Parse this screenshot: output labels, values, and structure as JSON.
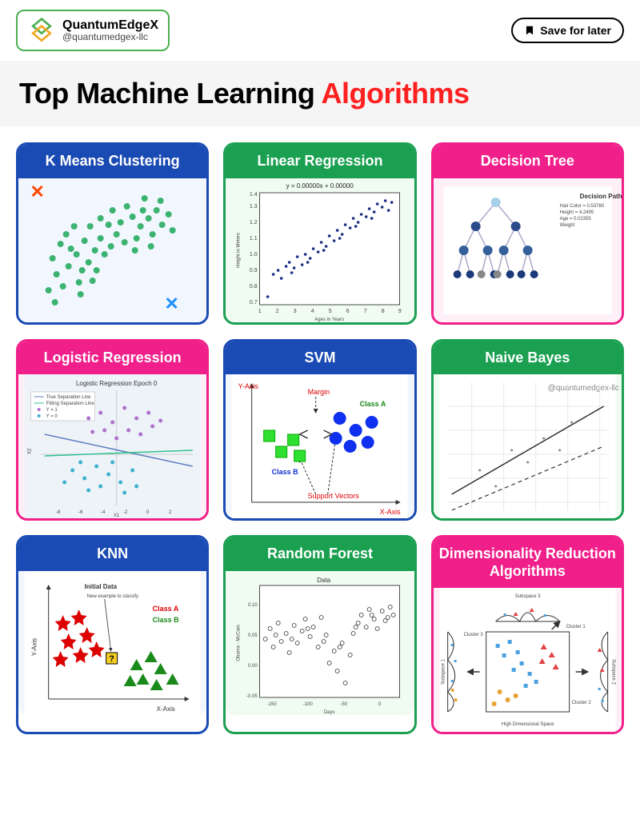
{
  "brand": {
    "name": "QuantumEdgeX",
    "handle": "@quantumedgex-llc"
  },
  "save_button": "Save for later",
  "title_prefix": "Top Machine Learning ",
  "title_accent": "Algorithms",
  "cards": {
    "kmeans": {
      "title": "K Means Clustering"
    },
    "linreg": {
      "title": "Linear Regression",
      "equation": "y = 0.00000x + 0.00000",
      "xlabel": "Ages in Years",
      "ylabel": "Height in Meters"
    },
    "dtree": {
      "title": "Decision Tree",
      "panel_title": "Decision Path",
      "panel_lines": [
        "Hair Color = 0.53780",
        "Height = 4.2495",
        "Age = 0.02355",
        "Weight"
      ]
    },
    "logreg": {
      "title": "Logistic Regression",
      "subtitle": "Logistic Regression Epoch 0",
      "legend": [
        "True Separation Line",
        "Fitting Separation Line",
        "Y = 1",
        "Y = 0"
      ],
      "xlabel": "X1",
      "ylabel": "X2"
    },
    "svm": {
      "title": "SVM",
      "labels": {
        "xaxis": "X-Axis",
        "yaxis": "Y-Axis",
        "margin": "Margin",
        "classA": "Class A",
        "classB": "Class B",
        "sv": "Support Vectors"
      }
    },
    "nb": {
      "title": "Naive Bayes",
      "watermark": "@quantumedgex-llc"
    },
    "knn": {
      "title": "KNN",
      "labels": {
        "initial": "Initial Data",
        "new": "New example to classify",
        "classA": "Class A",
        "classB": "Class B",
        "xaxis": "X-Axis",
        "yaxis": "Y-Axis",
        "question": "?"
      }
    },
    "rf": {
      "title": "Random Forest",
      "subtitle": "Data",
      "xlabel": "Days",
      "ylabel": "Obama - McCain"
    },
    "dimred": {
      "title": "Dimensionality Reduction Algorithms",
      "labels": {
        "hds": "High Dimensional Space",
        "s1": "Subspace 1",
        "s2": "Subspace 2",
        "s3": "Subspace 3",
        "c1": "Cluster 1",
        "c2": "Cluster 2",
        "c3": "Cluster 3"
      }
    }
  },
  "chart_data": [
    {
      "type": "scatter",
      "title": "K Means Clustering",
      "series": [
        {
          "name": "cluster-points",
          "color": "#3cb371",
          "values_note": "approx 70 green dots in two loose clusters"
        },
        {
          "name": "centroid-1",
          "color": "#ff4500",
          "x": 15,
          "y": 15,
          "marker": "x"
        },
        {
          "name": "centroid-2",
          "color": "#1e90ff",
          "x": 180,
          "y": 155,
          "marker": "x"
        }
      ]
    },
    {
      "type": "scatter",
      "title": "Linear Regression",
      "xlabel": "Ages in Years",
      "ylabel": "Height in Meters",
      "xlim": [
        1,
        9
      ],
      "ylim": [
        0.7,
        1.4
      ],
      "equation": "y = 0.00000x + 0.00000",
      "series": [
        {
          "name": "data",
          "values_note": "approx 60 scattered blue dots showing positive trend"
        }
      ]
    },
    {
      "type": "tree",
      "title": "Decision Tree",
      "levels": 4,
      "leaf_count": 8,
      "decision_path": [
        "Hair Color = 0.53780",
        "Height = 4.2495",
        "Age = 0.02355",
        "Weight"
      ]
    },
    {
      "type": "scatter",
      "title": "Logistic Regression Epoch 0",
      "xlabel": "X1",
      "ylabel": "X2",
      "xlim": [
        -10,
        10
      ],
      "ylim": [
        -10,
        10
      ],
      "series": [
        {
          "name": "Y = 1",
          "color": "#b070d0",
          "values_note": "violet dots above"
        },
        {
          "name": "Y = 0",
          "color": "#40b0d0",
          "values_note": "cyan dots below"
        },
        {
          "name": "True Separation Line",
          "type": "line"
        },
        {
          "name": "Fitting Separation Line",
          "type": "line"
        }
      ]
    },
    {
      "type": "diagram",
      "title": "SVM",
      "classes": [
        "Class A (blue circles)",
        "Class B (green squares)"
      ],
      "annotations": [
        "Margin",
        "Support Vectors",
        "X-Axis",
        "Y-Axis"
      ]
    },
    {
      "type": "line",
      "title": "Naive Bayes",
      "series": [
        {
          "name": "solid",
          "style": "solid"
        },
        {
          "name": "dashed",
          "style": "dashed"
        }
      ]
    },
    {
      "type": "scatter",
      "title": "KNN",
      "series": [
        {
          "name": "Class A",
          "marker": "star",
          "color": "#d00"
        },
        {
          "name": "Class B",
          "marker": "triangle",
          "color": "#1a8a1a"
        },
        {
          "name": "New example",
          "marker": "square-question",
          "color": "#e0c000"
        }
      ],
      "annotations": [
        "Initial Data",
        "New example to classify"
      ]
    },
    {
      "type": "scatter",
      "title": "Random Forest / Data",
      "xlabel": "Days",
      "ylabel": "Obama - McCain",
      "xlim": [
        -150,
        0
      ],
      "ylim": [
        -0.05,
        0.1
      ],
      "series": [
        {
          "name": "polls",
          "marker": "circle-open",
          "values_note": "approx 120 open circles"
        }
      ]
    },
    {
      "type": "diagram",
      "title": "Dimensionality Reduction",
      "center": "High Dimensional Space",
      "subspaces": [
        "Subspace 1",
        "Subspace 2",
        "Subspace 3"
      ],
      "clusters": [
        "Cluster 1",
        "Cluster 2",
        "Cluster 3"
      ]
    }
  ]
}
